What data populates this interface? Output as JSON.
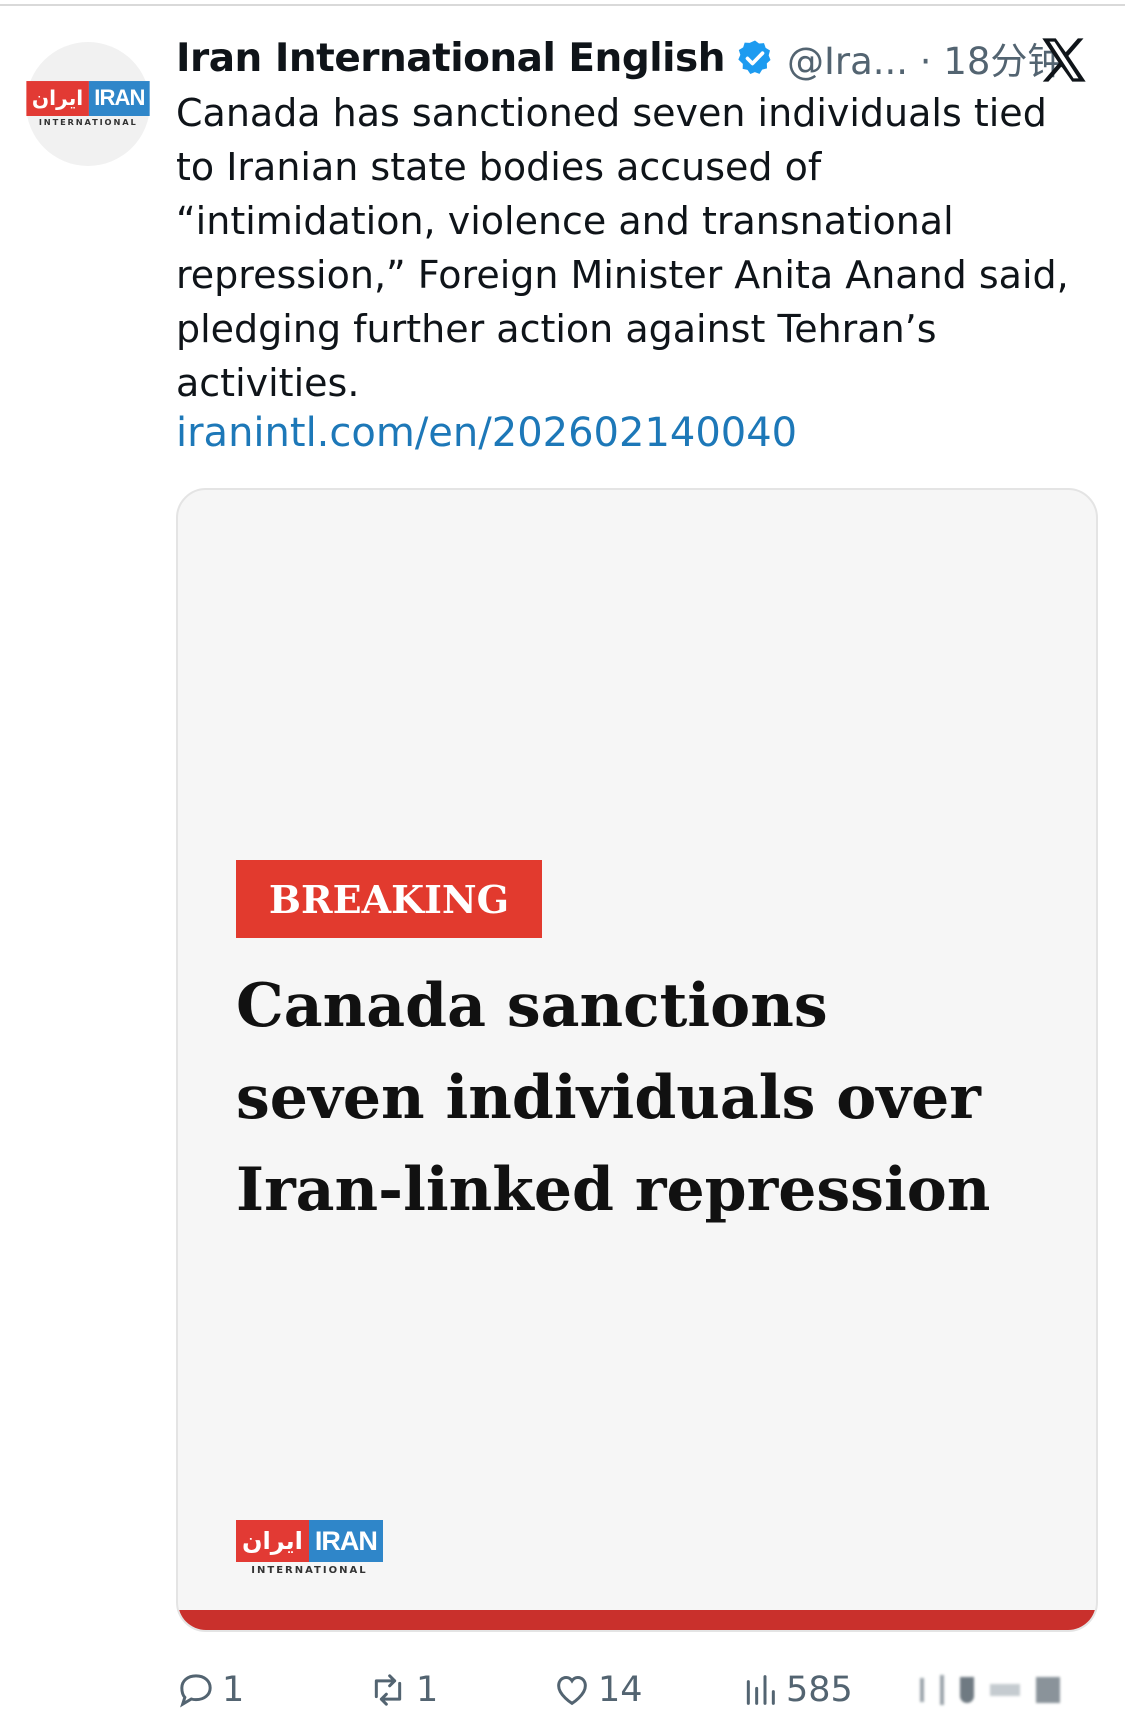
{
  "tweet": {
    "author_name": "Iran International English",
    "handle_time": "@Ira... · 18分钟",
    "text": "Canada has sanctioned seven individuals tied\nto Iranian state bodies accused of\n“intimidation, violence and transnational\nrepression,” Foreign Minister Anita Anand said,\npledging further action against Tehran’s\nactivities.",
    "link": "iranintl.com/en/202602140040"
  },
  "logo": {
    "red_text": "ایران",
    "blue_text": "IRAN",
    "sub_text": "INTERNATIONAL"
  },
  "card": {
    "tag": "BREAKING",
    "headline": "Canada sanctions seven individuals over Iran-linked repression"
  },
  "actions": {
    "replies": "1",
    "reposts": "1",
    "likes": "14",
    "views": "585"
  },
  "colors": {
    "link": "#1d78b8",
    "verified": "#1d9bf0",
    "breaking": "#e23a2e",
    "logo_red": "#e23a34",
    "logo_blue": "#2f86c9"
  },
  "icons": [
    "verified-badge-icon",
    "x-logo-icon",
    "reply-icon",
    "repost-icon",
    "like-icon",
    "views-icon"
  ]
}
